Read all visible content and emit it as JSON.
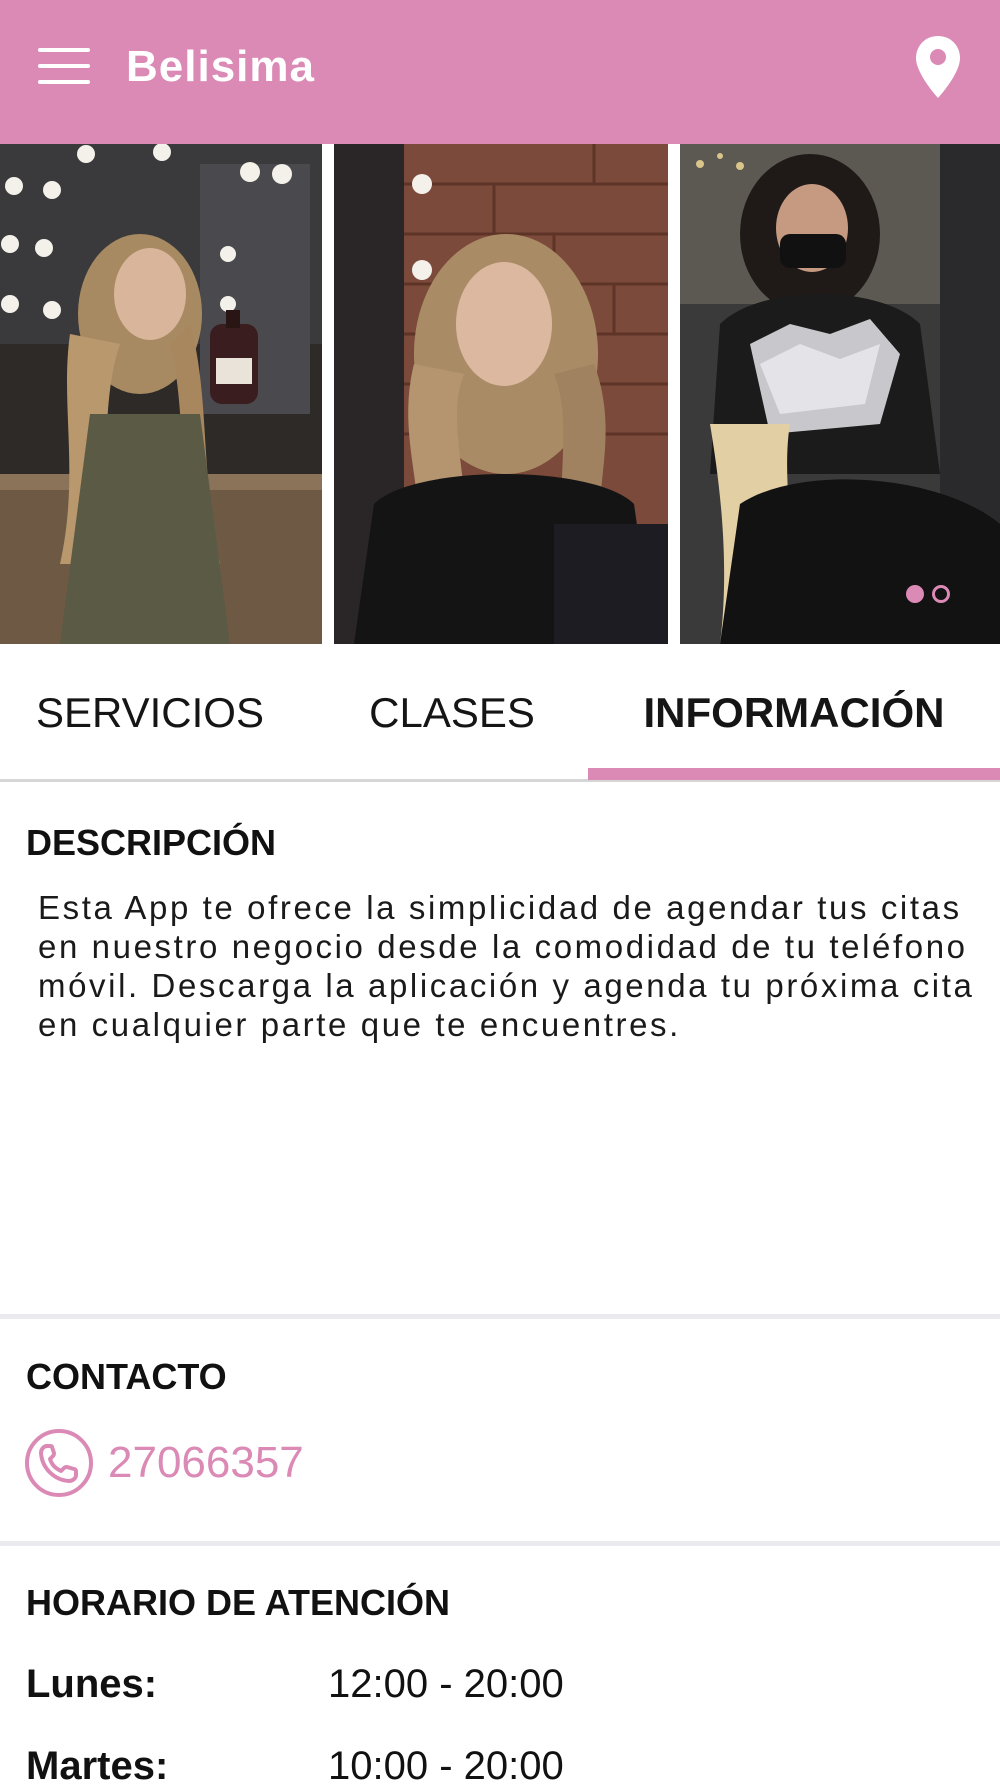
{
  "app": {
    "title": "Belisima"
  },
  "header": {
    "menu_icon": "hamburger-menu-icon",
    "location_icon": "map-pin-icon"
  },
  "carousel": {
    "photos": [
      "salon-photo-model-with-product",
      "salon-photo-model-portrait",
      "salon-photo-hair-coloring"
    ],
    "page_count": 2,
    "active_index": 0
  },
  "tabs": [
    {
      "label": "SERVICIOS",
      "active": false
    },
    {
      "label": "CLASES",
      "active": false
    },
    {
      "label": "INFORMACIÓN",
      "active": true
    }
  ],
  "description": {
    "title": "DESCRIPCIÓN",
    "text": "Esta App te ofrece la simplicidad de agendar tus citas en nuestro negocio desde la comodidad de tu teléfono móvil. Descarga la aplicación y agenda tu próxima cita en cualquier parte que te encuentres."
  },
  "contact": {
    "title": "CONTACTO",
    "phone": "27066357",
    "phone_icon": "phone-icon"
  },
  "hours": {
    "title": "HORARIO DE ATENCIÓN",
    "rows": [
      {
        "day": "Lunes:",
        "time": "12:00 - 20:00"
      },
      {
        "day": "Martes:",
        "time": "10:00 - 20:00"
      }
    ]
  },
  "colors": {
    "accent": "#db89b5",
    "divider": "#ebebef",
    "text": "#111111"
  }
}
